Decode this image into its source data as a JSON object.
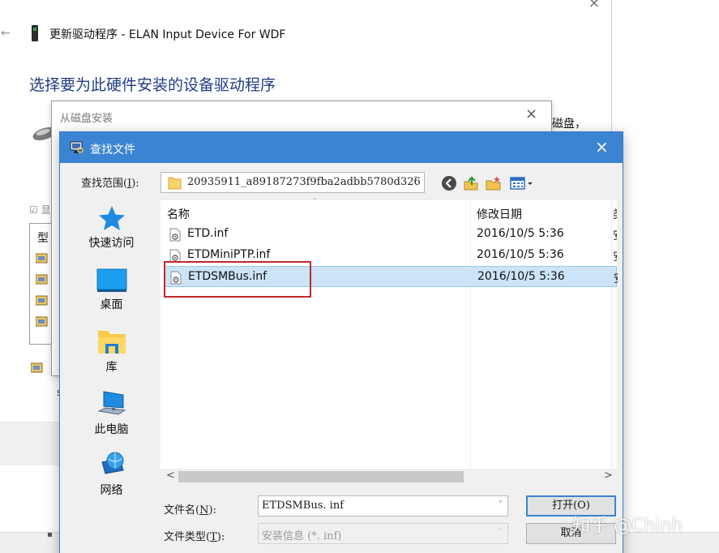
{
  "wizard": {
    "back_arrow": "←",
    "close": "×",
    "title": "更新驱动程序 - ELAN Input Device For WDF",
    "heading": "选择要为此硬件安装的设备驱动程序",
    "peek_text": "磁盘，",
    "checkbox_text": "☑ 显",
    "list_header": "型",
    "small_char": "s"
  },
  "disk_dialog": {
    "title": "从磁盘安装",
    "close": "×"
  },
  "find_dialog": {
    "title": "查找文件",
    "close": "×",
    "look_in": {
      "label": "查找范围(",
      "hotkey": "I",
      "label_end": "):",
      "value": "20935911_a89187273f9fba2adbb5780d326",
      "arrow": "˅"
    },
    "toolbar": [
      "back-icon",
      "up-folder-icon",
      "new-folder-icon",
      "view-menu-icon"
    ],
    "places": [
      {
        "label": "快速访问",
        "icon": "star-icon"
      },
      {
        "label": "桌面",
        "icon": "desktop-icon"
      },
      {
        "label": "库",
        "icon": "library-icon"
      },
      {
        "label": "此电脑",
        "icon": "computer-icon"
      },
      {
        "label": "网络",
        "icon": "network-icon"
      }
    ],
    "columns": {
      "name": "名称",
      "date": "修改日期",
      "type": "类"
    },
    "files": [
      {
        "name": "ETD.inf",
        "date": "2016/10/5 5:36",
        "type": "安",
        "selected": false
      },
      {
        "name": "ETDMiniPTP.inf",
        "date": "2016/10/5 5:36",
        "type": "安",
        "selected": false
      },
      {
        "name": "ETDSMBus.inf",
        "date": "2016/10/5 5:36",
        "type": "安",
        "selected": true
      }
    ],
    "scroll": {
      "left": "<",
      "right": ">"
    },
    "filename": {
      "label": "文件名(",
      "hotkey": "N",
      "label_end": "):",
      "value": "ETDSMBus. inf",
      "arrow": "˅"
    },
    "filetype": {
      "label": "文件类型(",
      "hotkey": "T",
      "label_end": "):",
      "value": "安装信息 (*. inf)",
      "arrow": "˅"
    },
    "open_button": "打开(O)",
    "cancel_button": "取消"
  },
  "watermark": "知乎 @Chinh",
  "colors": {
    "titlebar": "#3b84d4",
    "heading": "#1f3d86",
    "selection": "#cce4f7",
    "highlight": "#c0282b"
  }
}
